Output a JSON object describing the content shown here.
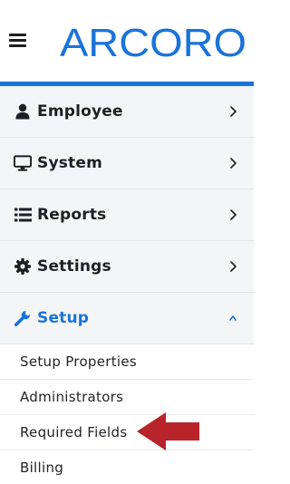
{
  "header": {
    "logo_text": "ARCORO",
    "menu_icon": "hamburger-menu-icon"
  },
  "colors": {
    "brand_blue": "#1a73d9",
    "annotation_red": "#b8242a",
    "menu_bg": "#f4f5f6",
    "text_dark": "#1d1f22"
  },
  "menu": {
    "items": [
      {
        "label": "Employee",
        "icon": "user-icon",
        "chevron": "chevron-right-icon"
      },
      {
        "label": "System",
        "icon": "monitor-icon",
        "chevron": "chevron-right-icon"
      },
      {
        "label": "Reports",
        "icon": "list-icon",
        "chevron": "chevron-right-icon"
      },
      {
        "label": "Settings",
        "icon": "gear-icon",
        "chevron": "chevron-right-icon"
      },
      {
        "label": "Setup",
        "icon": "wrench-icon",
        "chevron": "chevron-up-icon",
        "expanded": true
      }
    ],
    "setup_submenu": [
      {
        "label": "Setup Properties"
      },
      {
        "label": "Administrators"
      },
      {
        "label": "Required Fields",
        "highlighted": true
      },
      {
        "label": "Billing"
      }
    ]
  },
  "annotation": {
    "icon": "red-arrow-left-icon",
    "points_to": "Required Fields"
  }
}
